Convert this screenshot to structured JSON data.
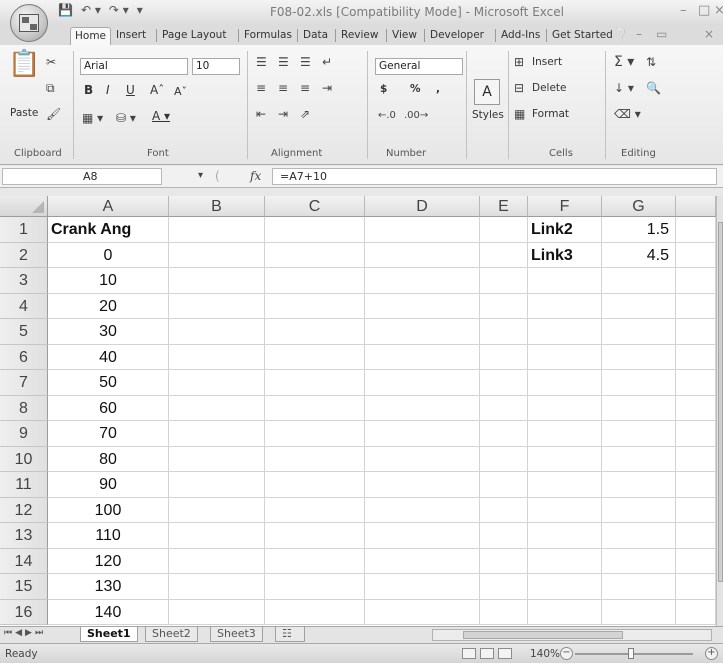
{
  "quick_access": {
    "save_icon": "save-icon",
    "undo_icon": "undo-icon",
    "redo_icon": "redo-icon"
  },
  "window": {
    "title": "F08-02.xls  [Compatibility Mode]  -  Microsoft Excel"
  },
  "ribbon_tabs": [
    "Home",
    "Insert",
    "Page Layout",
    "Formulas",
    "Data",
    "Review",
    "View",
    "Developer",
    "Add-Ins",
    "Get Started"
  ],
  "ribbon": {
    "clipboard": {
      "paste_label": "Paste",
      "group_label": "Clipboard"
    },
    "font": {
      "name": "Arial",
      "size": "10",
      "group_label": "Font"
    },
    "alignment": {
      "group_label": "Alignment"
    },
    "number": {
      "format": "General",
      "currency": "$",
      "percent": "%",
      "comma": ",",
      "group_label": "Number"
    },
    "styles": {
      "label": "Styles"
    },
    "cells": {
      "insert": "Insert",
      "delete": "Delete",
      "format": "Format",
      "group_label": "Cells"
    },
    "editing": {
      "group_label": "Editing"
    }
  },
  "formula_bar": {
    "name_box": "A8",
    "fx": "fx",
    "formula": "=A7+10"
  },
  "grid": {
    "columns": [
      "A",
      "B",
      "C",
      "D",
      "E",
      "F",
      "G"
    ],
    "rows": [
      "1",
      "2",
      "3",
      "4",
      "5",
      "6",
      "7",
      "8",
      "9",
      "10",
      "11",
      "12",
      "13",
      "14",
      "15",
      "16"
    ],
    "col_a": [
      "Crank Ang",
      "0",
      "10",
      "20",
      "30",
      "40",
      "50",
      "60",
      "70",
      "80",
      "90",
      "100",
      "110",
      "120",
      "130",
      "140"
    ],
    "col_f": [
      "Link2",
      "Link3"
    ],
    "col_g": [
      "1.5",
      "4.5"
    ]
  },
  "sheet_tabs": [
    "Sheet1",
    "Sheet2",
    "Sheet3"
  ],
  "status": {
    "ready": "Ready",
    "zoom": "140%"
  }
}
